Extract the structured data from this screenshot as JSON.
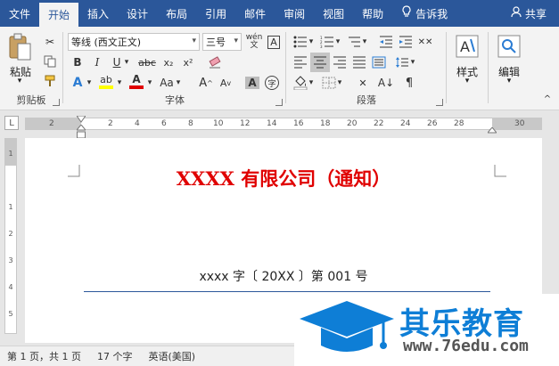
{
  "tabs": [
    "文件",
    "开始",
    "插入",
    "设计",
    "布局",
    "引用",
    "邮件",
    "审阅",
    "视图",
    "帮助",
    "告诉我",
    "共享"
  ],
  "ribbon": {
    "clipboard": {
      "label": "剪贴板",
      "paste": "粘贴"
    },
    "font": {
      "label": "字体",
      "font_name": "等线 (西文正文)",
      "font_size": "三号"
    },
    "paragraph": {
      "label": "段落"
    },
    "styles": {
      "label": "样式"
    },
    "editing": {
      "label": "编辑"
    }
  },
  "ruler": {
    "h_numbers": [
      "2",
      "2",
      "4",
      "6",
      "8",
      "10",
      "12",
      "14",
      "16",
      "18",
      "20",
      "22",
      "24",
      "26",
      "28",
      "30"
    ],
    "v_numbers": [
      "1",
      "1",
      "2",
      "3",
      "4",
      "5"
    ],
    "tab_selector": "L"
  },
  "document": {
    "title": "XXXX 有限公司（通知）",
    "ref_line": "xxxx 字〔 20XX 〕第 001 号",
    "title_color": "#e00000",
    "rule_color": "#2b579a"
  },
  "status": {
    "page": "第 1 页，共 1 页",
    "words": "17 个字",
    "language": "英语(美国)"
  },
  "watermark": {
    "name": "其乐教育",
    "url": "www.76edu.com"
  },
  "colors": {
    "accent": "#2b579a",
    "highlight": "#ffff00",
    "font_color": "#e00000"
  }
}
